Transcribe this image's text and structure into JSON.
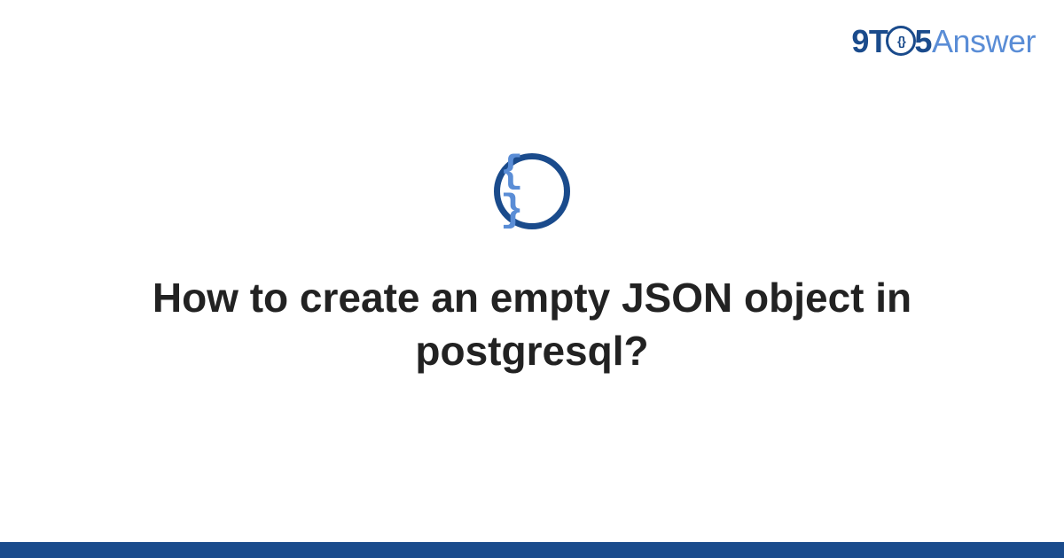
{
  "logo": {
    "part1": "9T",
    "circle_inner": "{}",
    "part2": "5",
    "part3": "Answer"
  },
  "icon": {
    "braces": "{ }"
  },
  "question": {
    "title": "How to create an empty JSON object in postgresql?"
  }
}
